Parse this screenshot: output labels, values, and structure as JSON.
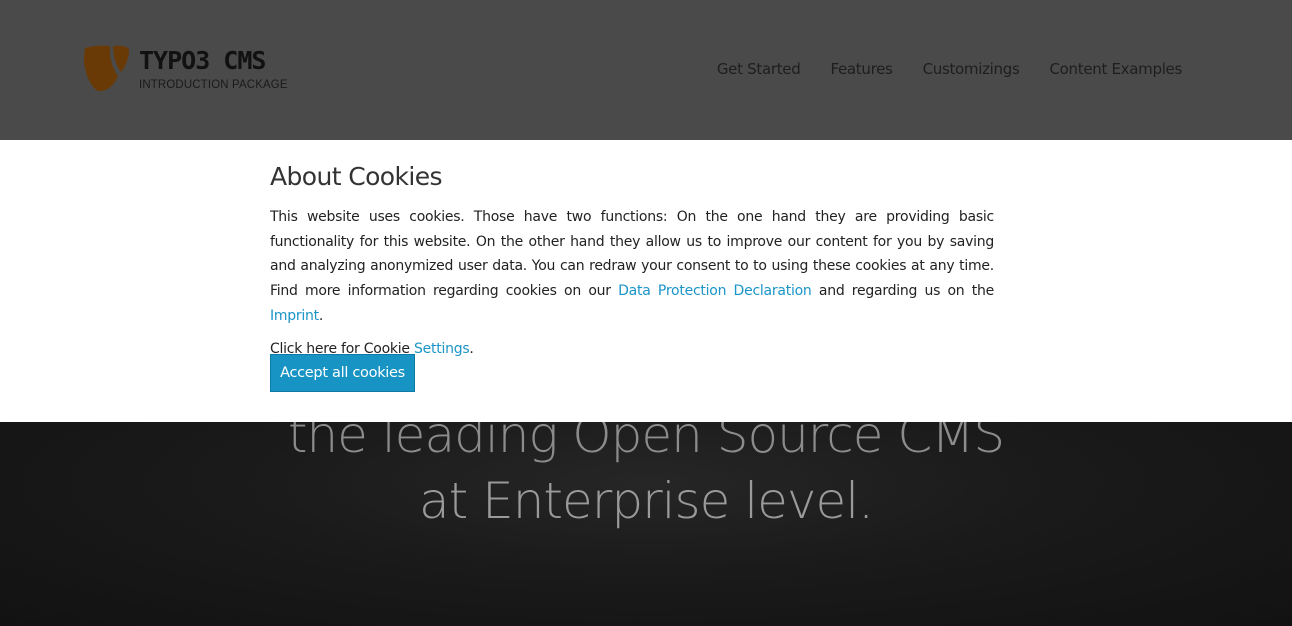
{
  "header": {
    "logo": {
      "title": "TYPO3 CMS",
      "subtitle": "INTRODUCTION PACKAGE",
      "mark_color": "#f49700"
    },
    "nav": [
      {
        "label": "Get Started"
      },
      {
        "label": "Features"
      },
      {
        "label": "Customizings"
      },
      {
        "label": "Content Examples"
      }
    ]
  },
  "hero": {
    "line1": "the leading Open Source CMS",
    "line2": "at Enterprise level."
  },
  "cookie_banner": {
    "title": "About Cookies",
    "text_1": "This website uses cookies. Those have two functions: On the one hand they are providing basic functionality for this website. On the other hand they allow us to improve our content for you by saving and analyzing anonymized user data. You can redraw your consent to to using these cookies at any time. Find more information regarding cookies on our ",
    "link_data_protection": "Data Protection Declaration",
    "text_2": " and regarding us on the ",
    "link_imprint": "Imprint",
    "text_3": ".",
    "settings_prefix": "Click here for Cookie ",
    "settings_link": "Settings",
    "settings_suffix": ".",
    "accept_label": "Accept all cookies",
    "accent_color": "#1794c4"
  }
}
